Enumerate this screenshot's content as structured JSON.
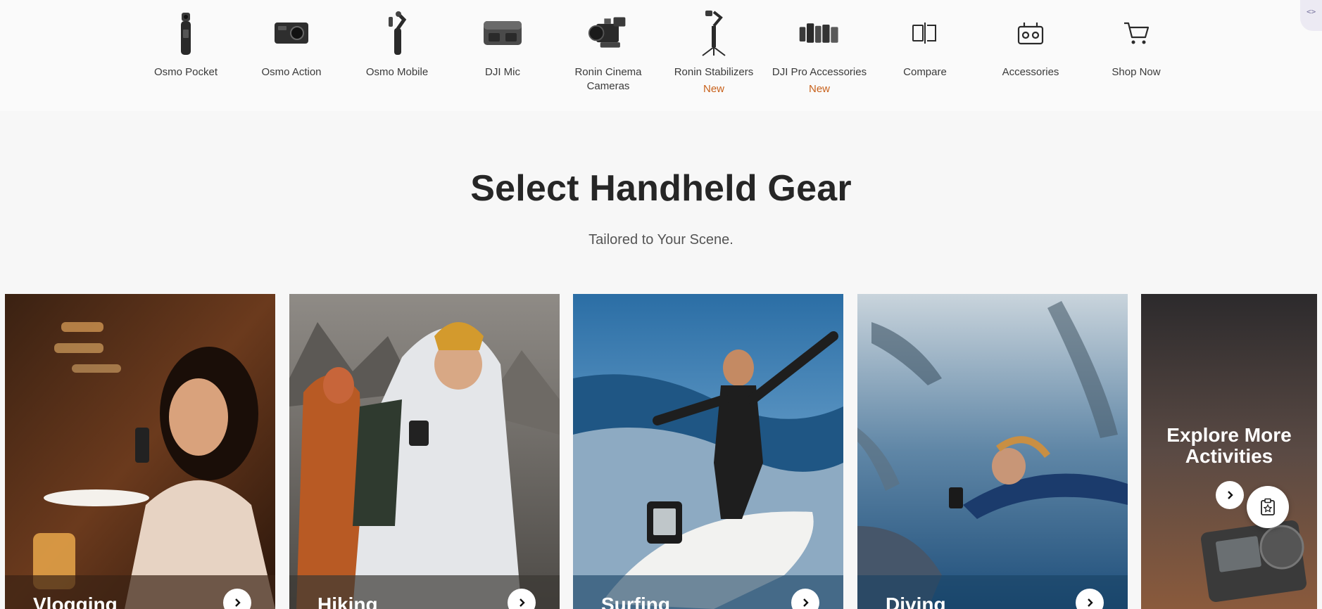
{
  "nav": {
    "items": [
      {
        "label": "Osmo Pocket",
        "badge": "",
        "icon": "osmo-pocket-icon"
      },
      {
        "label": "Osmo Action",
        "badge": "",
        "icon": "osmo-action-icon"
      },
      {
        "label": "Osmo Mobile",
        "badge": "",
        "icon": "osmo-mobile-icon"
      },
      {
        "label": "DJI Mic",
        "badge": "",
        "icon": "dji-mic-icon"
      },
      {
        "label": "Ronin Cinema Cameras",
        "badge": "",
        "icon": "ronin-cinema-camera-icon"
      },
      {
        "label": "Ronin Stabilizers",
        "badge": "New",
        "icon": "ronin-stabilizer-icon"
      },
      {
        "label": "DJI Pro Accessories",
        "badge": "New",
        "icon": "pro-accessories-icon"
      },
      {
        "label": "Compare",
        "badge": "",
        "icon": "compare-icon"
      },
      {
        "label": "Accessories",
        "badge": "",
        "icon": "accessories-icon"
      },
      {
        "label": "Shop Now",
        "badge": "",
        "icon": "cart-icon"
      }
    ]
  },
  "hero": {
    "title": "Select Handheld Gear",
    "subtitle": "Tailored to Your Scene."
  },
  "cards": [
    {
      "label": "Vlogging"
    },
    {
      "label": "Hiking"
    },
    {
      "label": "Surfing"
    },
    {
      "label": "Diving"
    }
  ],
  "explore": {
    "title": "Explore More Activities"
  },
  "colors": {
    "badge": "#c8611b",
    "page_bg": "#f7f7f7",
    "nav_bg": "#fafafa"
  }
}
